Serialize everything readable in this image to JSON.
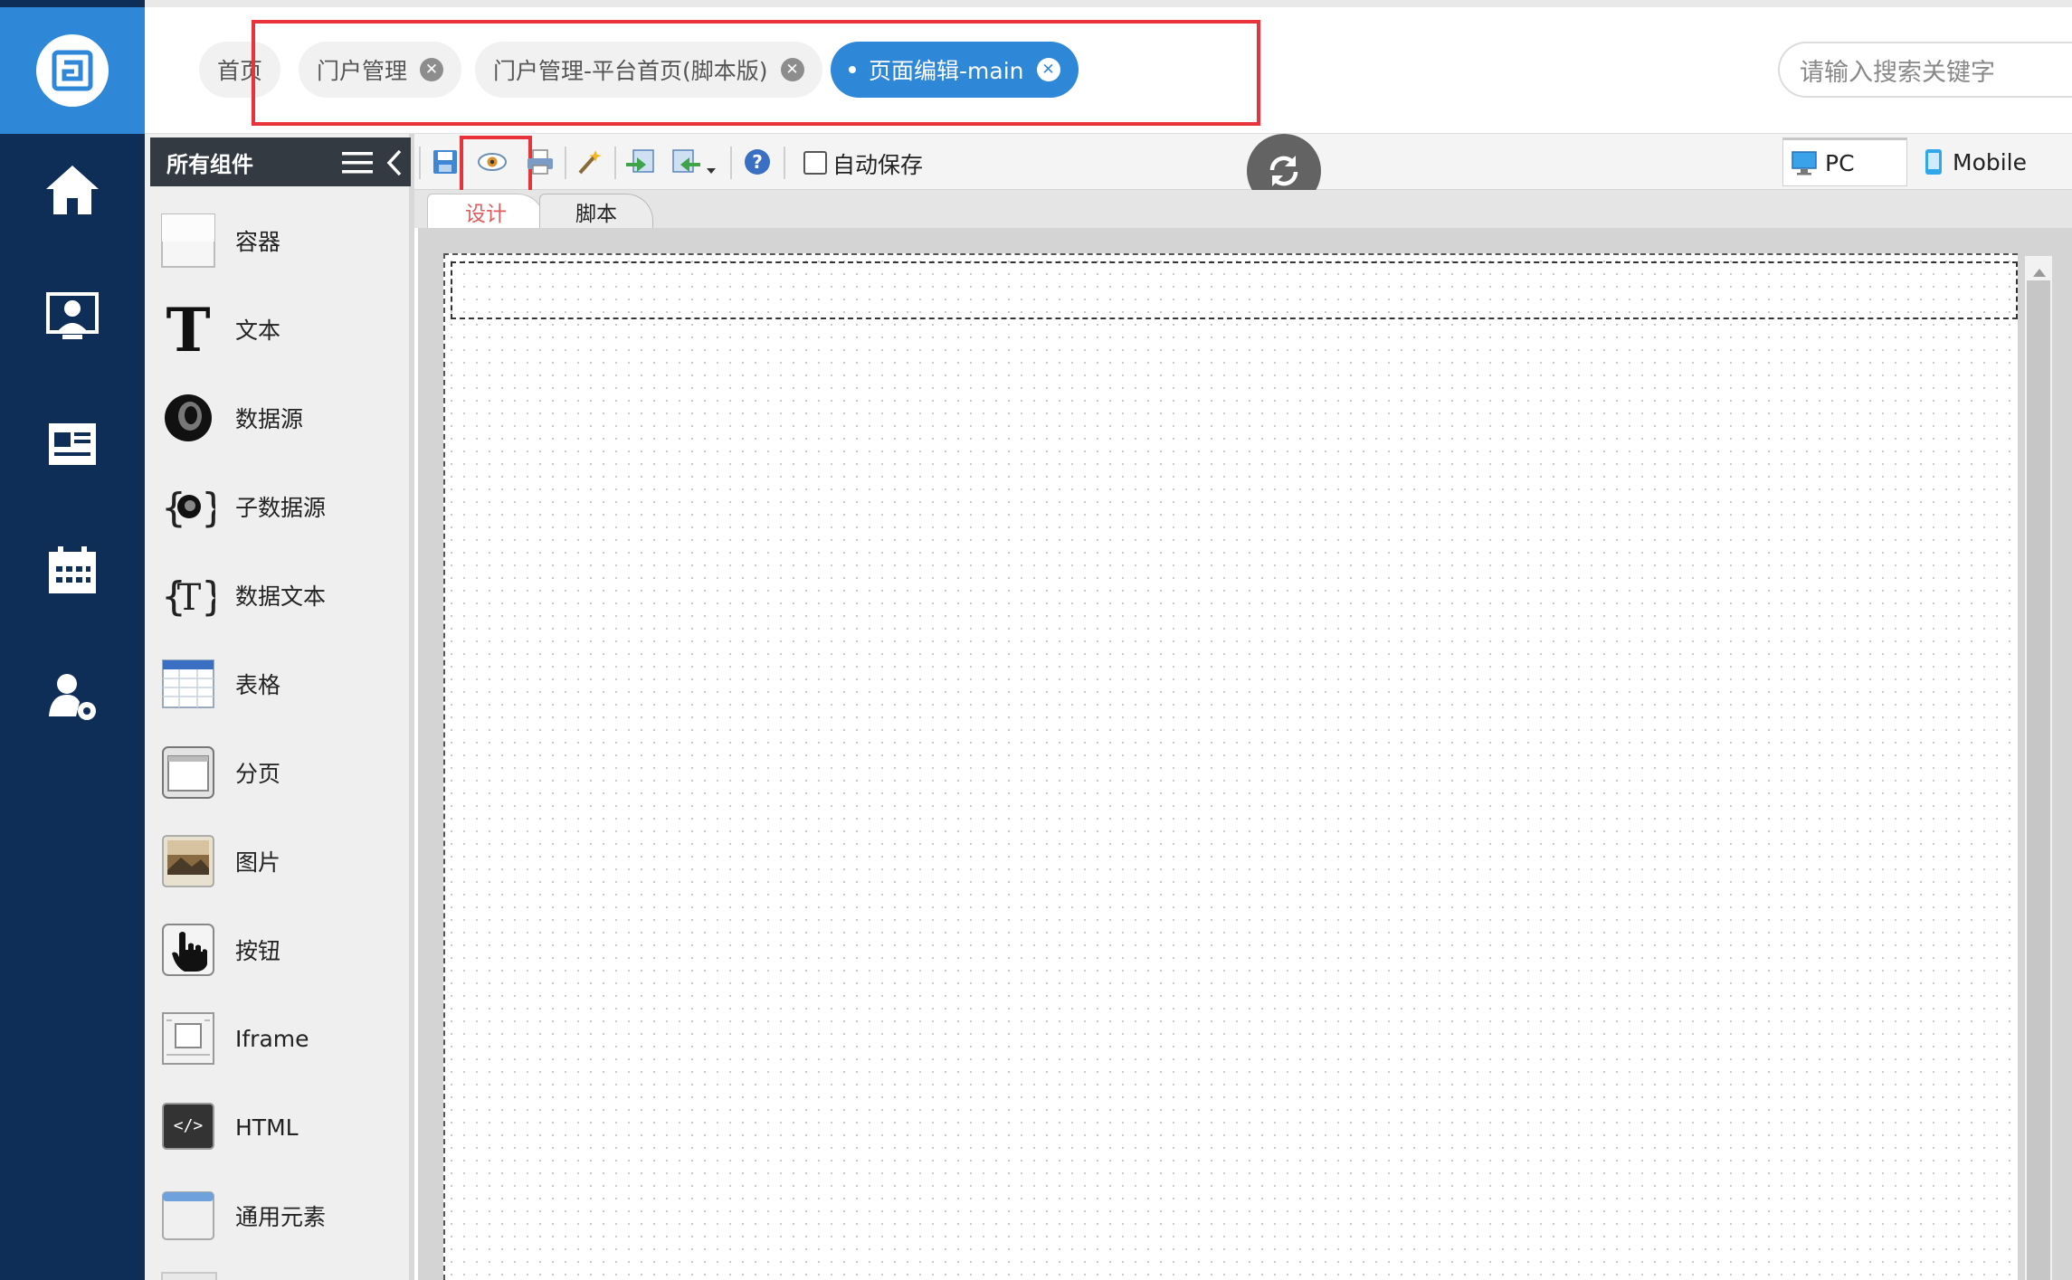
{
  "rail": {
    "items": [
      {
        "icon": "home-icon"
      },
      {
        "icon": "user-monitor-icon"
      },
      {
        "icon": "news-icon"
      },
      {
        "icon": "calendar-icon"
      },
      {
        "icon": "user-settings-icon"
      }
    ]
  },
  "tabs": [
    {
      "label": "首页"
    },
    {
      "label": "门户管理"
    },
    {
      "label": "门户管理-平台首页(脚本版)"
    },
    {
      "label": "页面编辑-main"
    }
  ],
  "search": {
    "placeholder": "请输入搜索关键字"
  },
  "panel": {
    "title": "所有组件",
    "components": [
      {
        "label": "容器",
        "icon": "container-icon"
      },
      {
        "label": "文本",
        "icon": "text-icon"
      },
      {
        "label": "数据源",
        "icon": "datasource-icon"
      },
      {
        "label": "子数据源",
        "icon": "sub-datasource-icon"
      },
      {
        "label": "数据文本",
        "icon": "data-text-icon"
      },
      {
        "label": "表格",
        "icon": "table-icon"
      },
      {
        "label": "分页",
        "icon": "pagination-icon"
      },
      {
        "label": "图片",
        "icon": "image-icon"
      },
      {
        "label": "按钮",
        "icon": "button-icon"
      },
      {
        "label": "Iframe",
        "icon": "iframe-icon"
      },
      {
        "label": "HTML",
        "icon": "html-icon"
      },
      {
        "label": "通用元素",
        "icon": "generic-element-icon"
      }
    ]
  },
  "toolbar": {
    "autosave_label": "自动保存",
    "pc_label": "PC",
    "mobile_label": "Mobile"
  },
  "design_tabs": [
    {
      "label": "设计"
    },
    {
      "label": "脚本"
    }
  ],
  "colors": {
    "rail": "#0e2d57",
    "accent": "#2f87d8",
    "highlight": "#e8333a"
  }
}
